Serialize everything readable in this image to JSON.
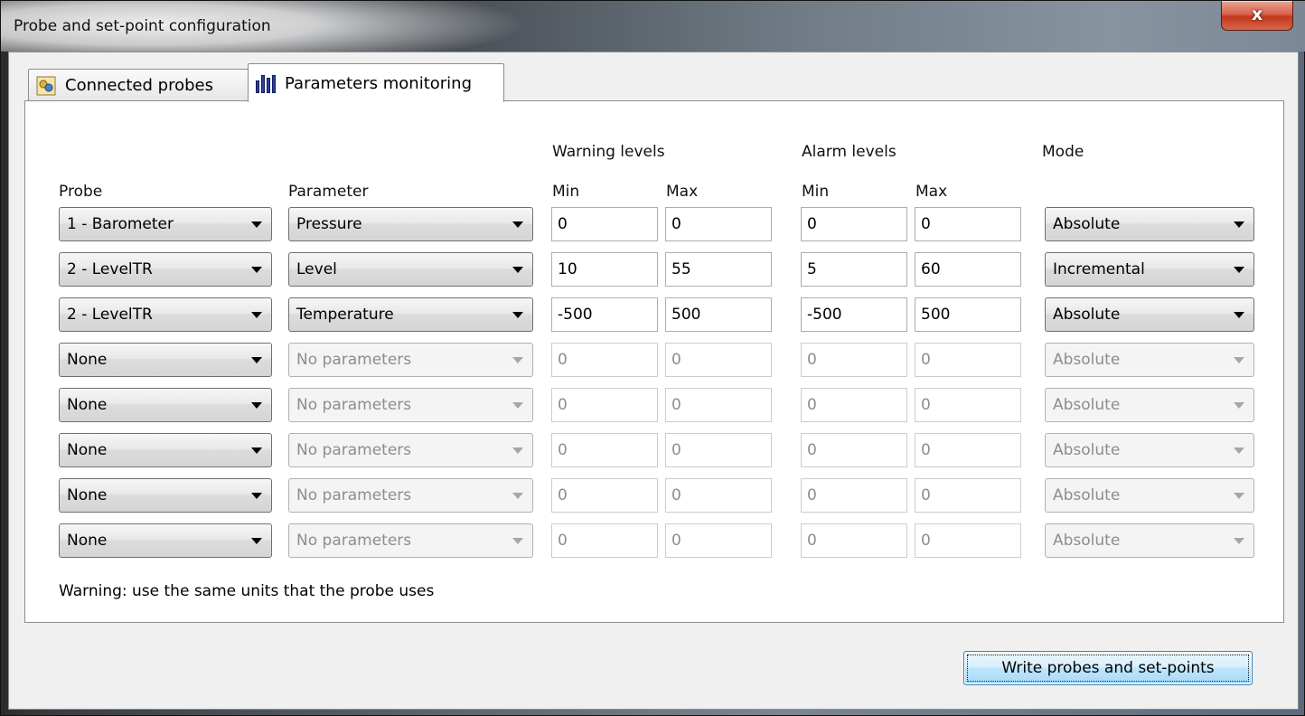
{
  "window": {
    "title": "Probe and set-point configuration",
    "close_label": "x"
  },
  "tabs": [
    {
      "label": "Connected probes",
      "icon": "probes-icon"
    },
    {
      "label": "Parameters monitoring",
      "icon": "bar-chart-icon"
    }
  ],
  "headers": {
    "probe": "Probe",
    "parameter": "Parameter",
    "warning_levels": "Warning levels",
    "alarm_levels": "Alarm levels",
    "mode": "Mode",
    "warning_min": "Min",
    "warning_max": "Max",
    "alarm_min": "Min",
    "alarm_max": "Max"
  },
  "rows": [
    {
      "probe": "1 - Barometer",
      "parameter": "Pressure",
      "warn_min": "0",
      "warn_max": "0",
      "alarm_min": "0",
      "alarm_max": "0",
      "mode": "Absolute",
      "enabled": true
    },
    {
      "probe": "2 - LevelTR",
      "parameter": "Level",
      "warn_min": "10",
      "warn_max": "55",
      "alarm_min": "5",
      "alarm_max": "60",
      "mode": "Incremental",
      "enabled": true
    },
    {
      "probe": "2 - LevelTR",
      "parameter": "Temperature",
      "warn_min": "-500",
      "warn_max": "500",
      "alarm_min": "-500",
      "alarm_max": "500",
      "mode": "Absolute",
      "enabled": true
    },
    {
      "probe": "None",
      "parameter": "No parameters",
      "warn_min": "0",
      "warn_max": "0",
      "alarm_min": "0",
      "alarm_max": "0",
      "mode": "Absolute",
      "enabled": false
    },
    {
      "probe": "None",
      "parameter": "No parameters",
      "warn_min": "0",
      "warn_max": "0",
      "alarm_min": "0",
      "alarm_max": "0",
      "mode": "Absolute",
      "enabled": false
    },
    {
      "probe": "None",
      "parameter": "No parameters",
      "warn_min": "0",
      "warn_max": "0",
      "alarm_min": "0",
      "alarm_max": "0",
      "mode": "Absolute",
      "enabled": false
    },
    {
      "probe": "None",
      "parameter": "No parameters",
      "warn_min": "0",
      "warn_max": "0",
      "alarm_min": "0",
      "alarm_max": "0",
      "mode": "Absolute",
      "enabled": false
    },
    {
      "probe": "None",
      "parameter": "No parameters",
      "warn_min": "0",
      "warn_max": "0",
      "alarm_min": "0",
      "alarm_max": "0",
      "mode": "Absolute",
      "enabled": false
    }
  ],
  "note": "Warning: use the same units that the probe uses",
  "write_button": "Write probes and set-points"
}
